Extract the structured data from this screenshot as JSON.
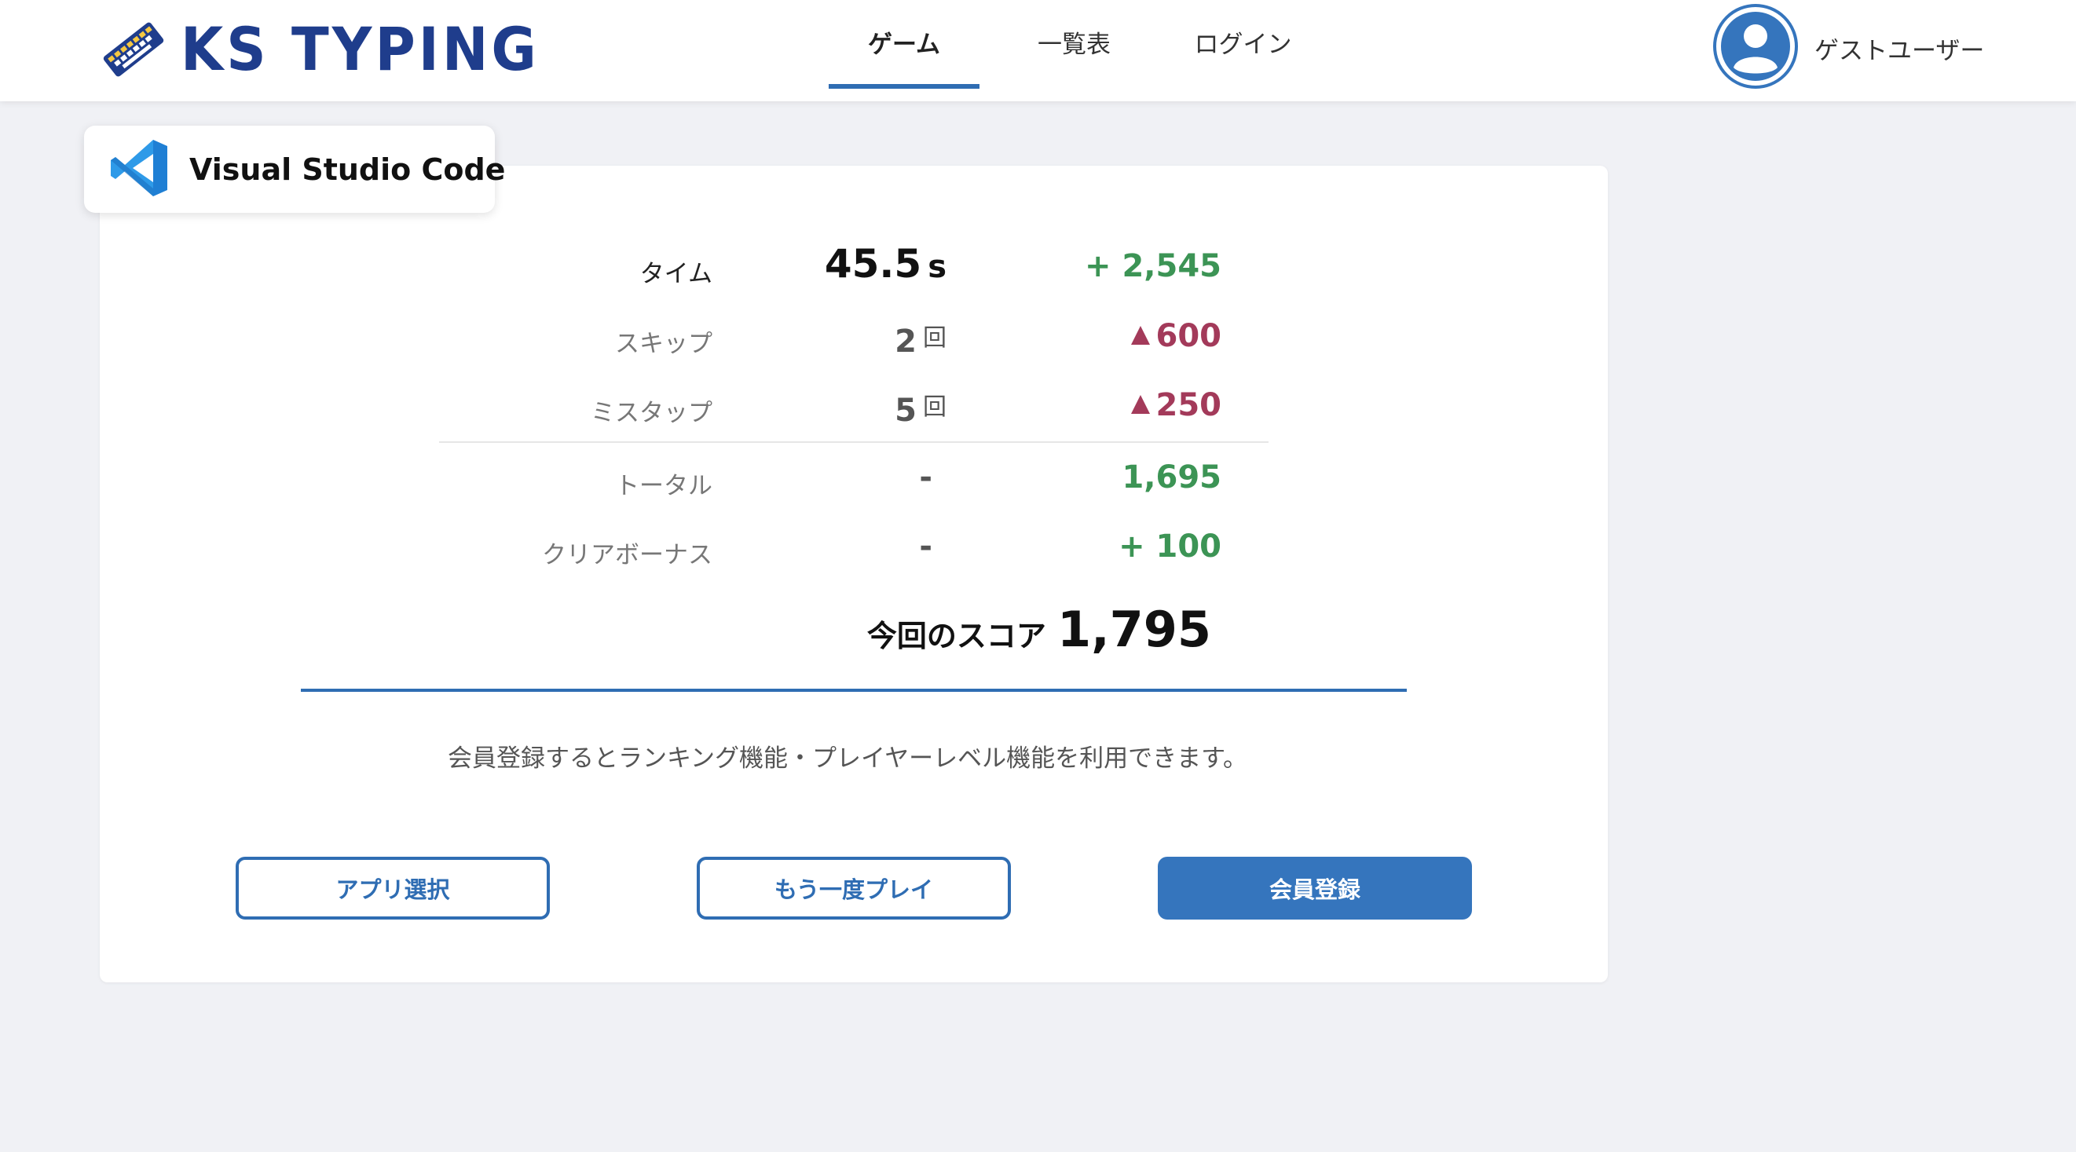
{
  "header": {
    "logo_text": "KS TYPING",
    "nav": [
      "ゲーム",
      "一覧表",
      "ログイン"
    ],
    "active_nav": "ゲーム",
    "user_name": "ゲストユーザー"
  },
  "app": {
    "name": "Visual Studio Code"
  },
  "results": {
    "rows": [
      {
        "label": "タイム",
        "value": "45.5",
        "unit": "s",
        "points": "+ 2,545",
        "sign": "positive"
      },
      {
        "label": "スキップ",
        "value": "2",
        "unit": "回",
        "points": "600",
        "sign": "negative"
      },
      {
        "label": "ミスタップ",
        "value": "5",
        "unit": "回",
        "points": "250",
        "sign": "negative"
      },
      {
        "label": "トータル",
        "value": "-",
        "unit": "",
        "points": "1,695",
        "sign": "positive"
      },
      {
        "label": "クリアボーナス",
        "value": "-",
        "unit": "",
        "points": "+ 100",
        "sign": "positive"
      }
    ],
    "score_label": "今回のスコア",
    "score_value": "1,795"
  },
  "notice": "会員登録するとランキング機能・プレイヤーレベル機能を利用できます。",
  "buttons": {
    "app_select": "アプリ選択",
    "replay": "もう一度プレイ",
    "register": "会員登録"
  },
  "colors": {
    "accent": "#2f6db3",
    "positive": "#3c9455",
    "negative": "#a33a5a",
    "background": "#f0f1f5"
  }
}
